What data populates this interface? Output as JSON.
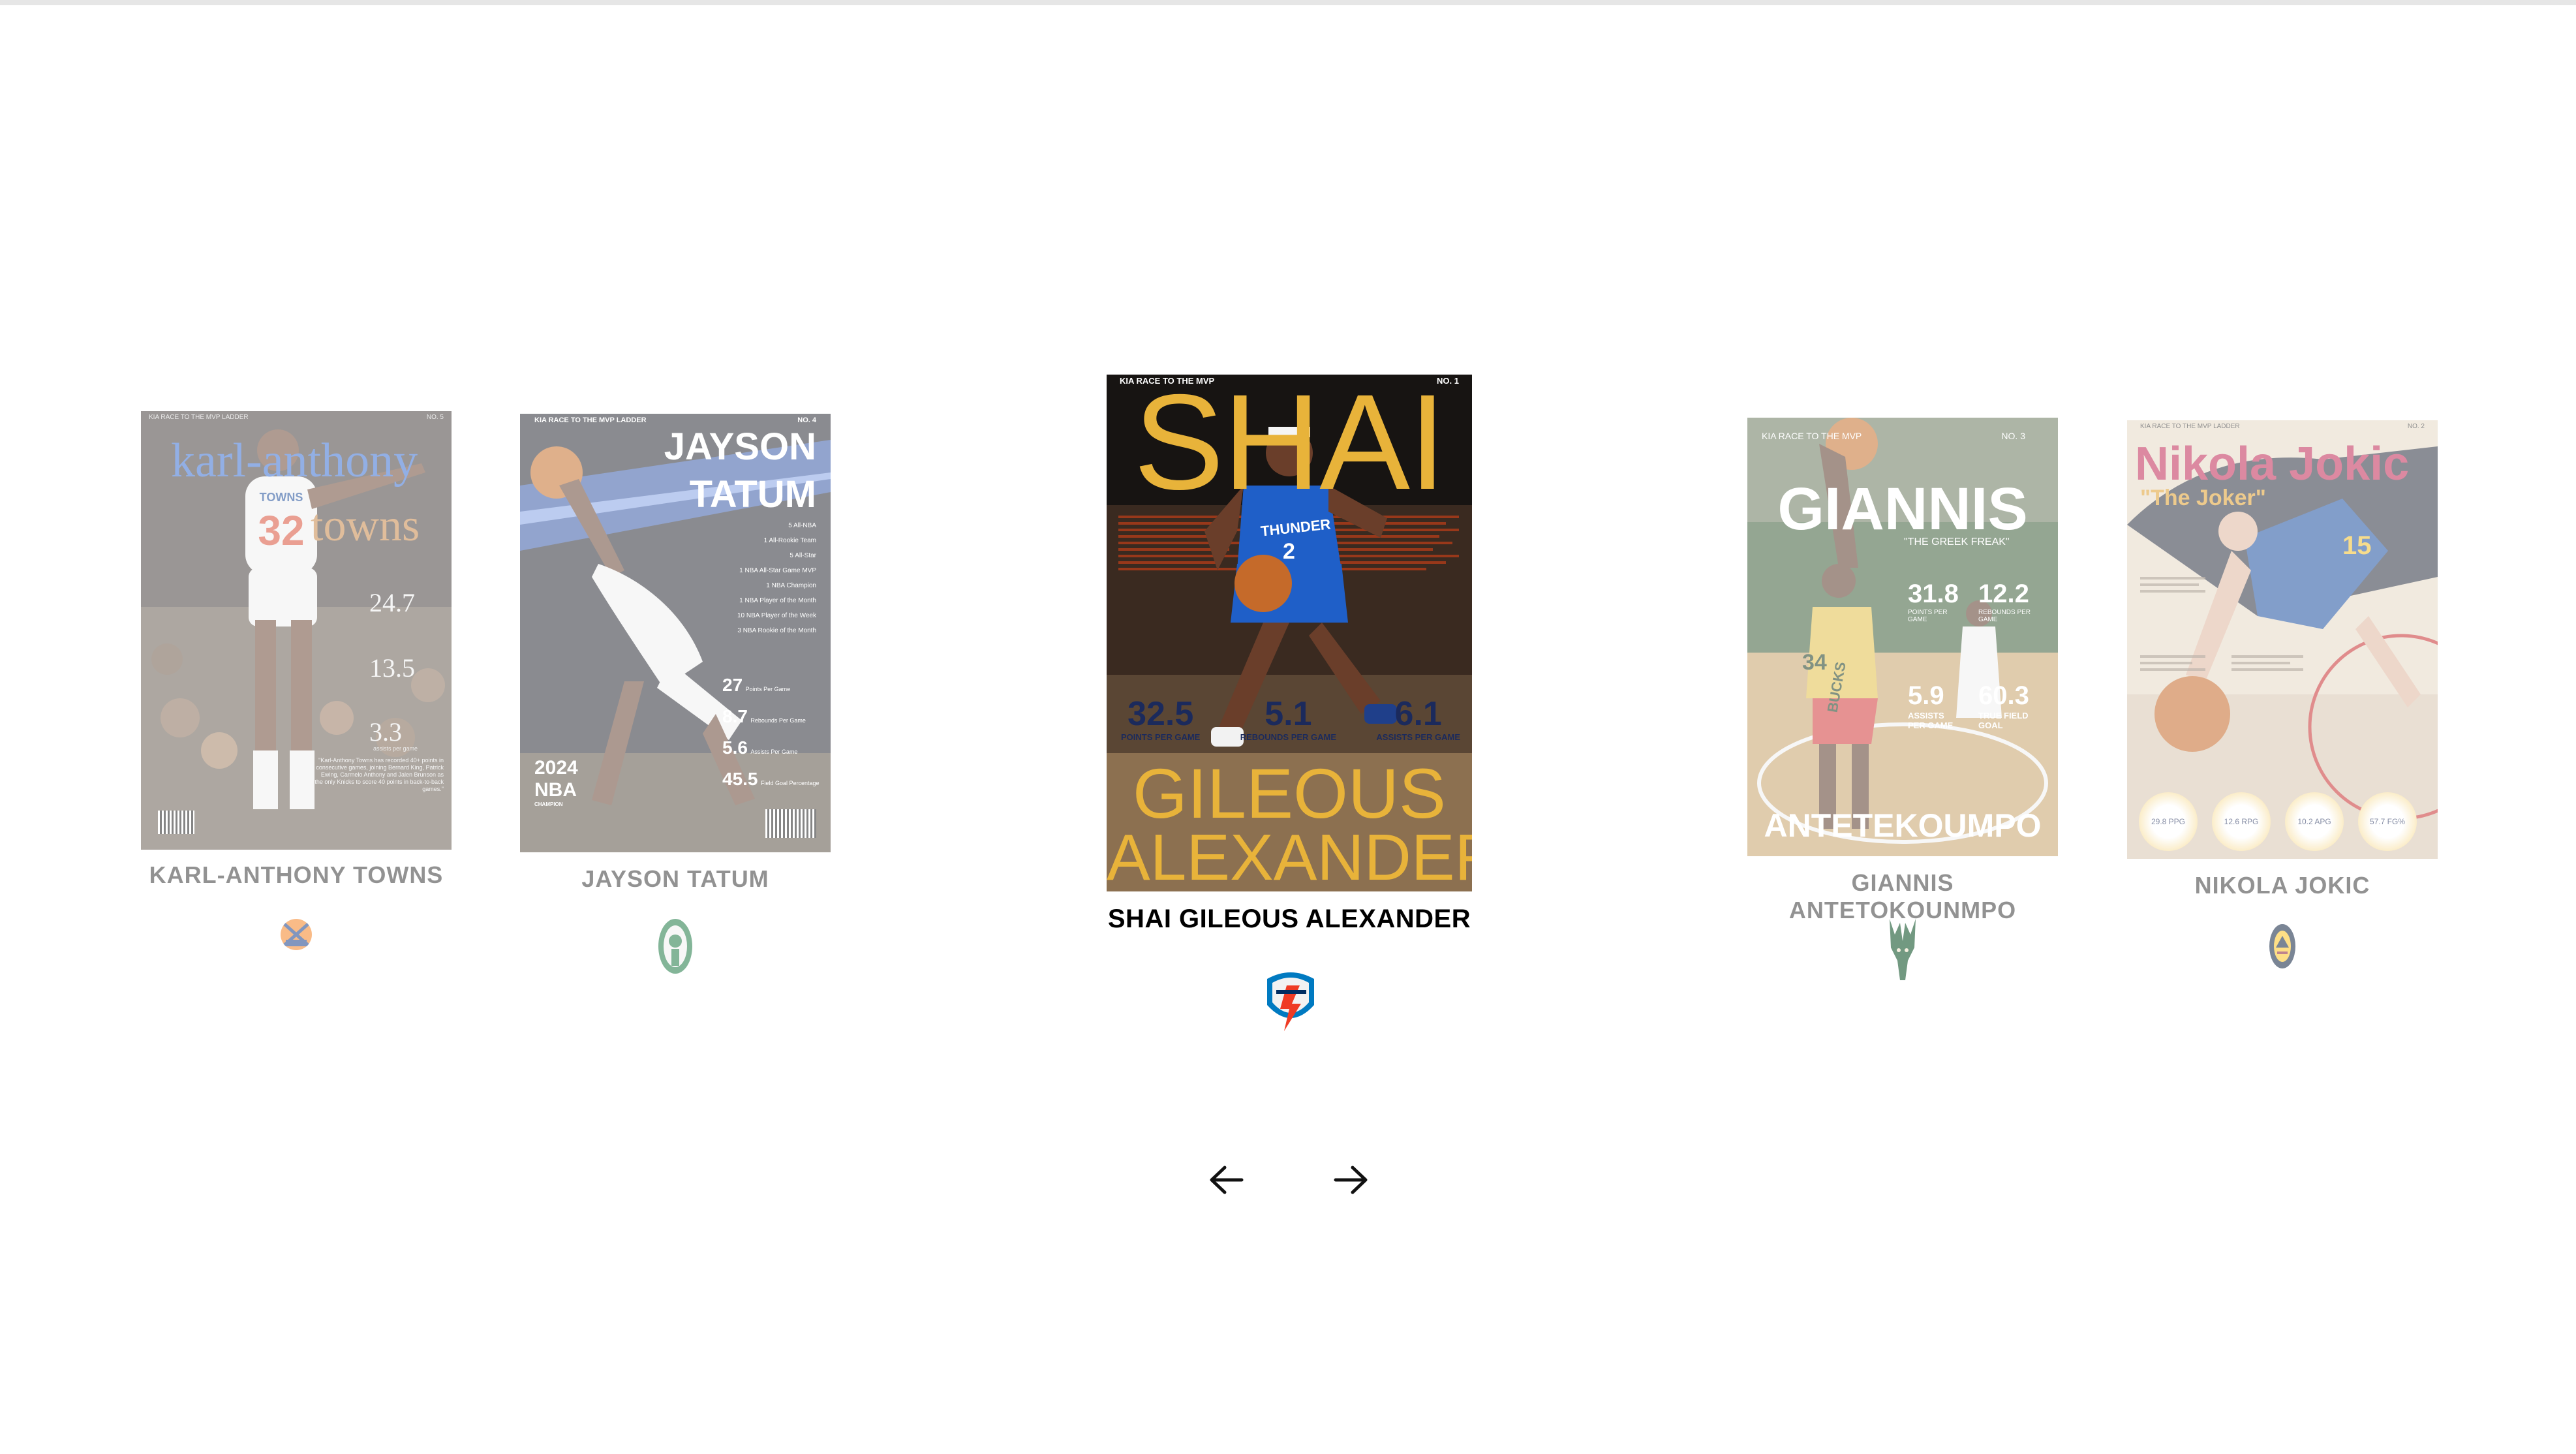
{
  "carousel": {
    "active_index": 2,
    "prev_label": "previous",
    "next_label": "next",
    "cards": [
      {
        "player": "KARL-ANTHONY TOWNS",
        "team_logo": "knicks-logo-icon",
        "cover": {
          "kicker": "KIA RACE TO THE MVP LADDER",
          "number": "NO. 5",
          "headline_1": "karl-anthony",
          "headline_2": "towns",
          "stat_1": "24.7",
          "stat_2": "13.5",
          "stat_3": "3.3",
          "stat_3_label": "assists per game",
          "jersey": "32",
          "jersey_name": "TOWNS",
          "quote": "\"Karl-Anthony Towns has recorded 40+ points in consecutive games, joining Bernard King, Patrick Ewing, Carmelo Anthony and Jalen Brunson as the only Knicks to score 40 points in back-to-back games.\""
        }
      },
      {
        "player": "JAYSON TATUM",
        "team_logo": "celtics-logo-icon",
        "cover": {
          "kicker": "KIA RACE TO THE MVP LADDER",
          "number": "NO. 4",
          "headline_1": "JAYSON",
          "headline_2": "TATUM",
          "honors": [
            "5 All-NBA",
            "1 All-Rookie Team",
            "5 All-Star",
            "1 NBA All-Star Game MVP",
            "1 NBA Champion",
            "1 NBA Player of the Month",
            "10 NBA Player of the Week",
            "3 NBA Rookie of the Month"
          ],
          "stats": [
            {
              "value": "27",
              "label": "Points Per Game"
            },
            {
              "value": "8.7",
              "label": "Rebounds Per Game"
            },
            {
              "value": "5.6",
              "label": "Assists Per Game"
            },
            {
              "value": "45.5",
              "label": "Field Goal Percentage"
            }
          ],
          "champ_year": "2024",
          "champ_league": "NBA",
          "champ_word": "CHAMPION"
        }
      },
      {
        "player": "SHAI GILEOUS ALEXANDER",
        "team_logo": "thunder-logo-icon",
        "cover": {
          "kicker": "KIA RACE TO THE MVP",
          "number": "NO. 1",
          "headline_1": "SHAI",
          "headline_2": "GILEOUS",
          "headline_3": "ALEXANDER",
          "jersey_word": "THUNDER",
          "jersey_number": "2",
          "stats": [
            {
              "value": "32.5",
              "label": "POINTS PER GAME"
            },
            {
              "value": "5.1",
              "label": "REBOUNDS PER GAME"
            },
            {
              "value": "6.1",
              "label": "ASSISTS PER GAME"
            }
          ]
        }
      },
      {
        "player": "GIANNIS ANTETOKOUNMPO",
        "team_logo": "bucks-logo-icon",
        "cover": {
          "kicker": "KIA RACE TO THE MVP",
          "number": "NO. 3",
          "headline_1": "GIANNIS",
          "tagline": "\"THE GREEK FREAK\"",
          "headline_2": "ANTETEKOUMPO",
          "jersey_word": "BUCKS",
          "jersey_number": "34",
          "stats": [
            {
              "value": "31.8",
              "label": "POINTS PER GAME"
            },
            {
              "value": "12.2",
              "label": "REBOUNDS PER GAME"
            },
            {
              "value": "5.9",
              "label": "ASSISTS PER GAME"
            },
            {
              "value": "60.3",
              "label": "TRUE FIELD GOAL"
            }
          ]
        }
      },
      {
        "player": "NIKOLA JOKIC",
        "team_logo": "nuggets-logo-icon",
        "cover": {
          "kicker": "KIA RACE TO THE MVP LADDER",
          "number": "NO. 2",
          "headline_1": "Nikola Jokic",
          "tagline": "\"The Joker\"",
          "jersey_number": "15",
          "stats": [
            "29.8 PPG",
            "12.6 RPG",
            "10.2 APG",
            "57.7 FG%"
          ]
        }
      }
    ]
  },
  "colors": {
    "thunder_gold": "#e8b33a",
    "thunder_navy": "#1b2a5c",
    "knicks_blue": "#2a5bb0",
    "celtics_green": "#1e7a45",
    "bucks_green": "#2f6a3b",
    "nuggets_navy": "#1d2b57",
    "jokic_title": "#c12a55"
  }
}
